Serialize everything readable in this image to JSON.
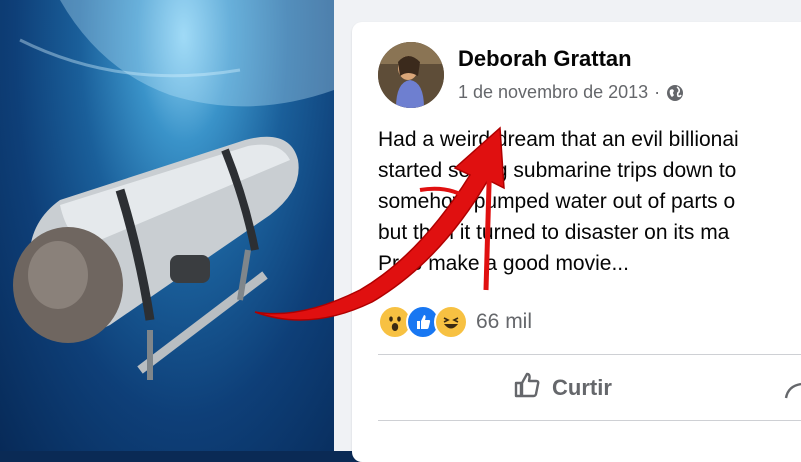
{
  "post": {
    "author_name": "Deborah Grattan",
    "date": "1 de novembro de 2013",
    "separator": "·",
    "privacy_icon": "globe-icon",
    "lines": [
      "Had a weird dream that an evil billionai",
      "started selling submarine trips down to",
      "somehow pumped water out of parts o",
      "but then it turned to disaster on its ma",
      "Prob make a good movie..."
    ],
    "reactions": [
      "wow-icon",
      "like-icon",
      "haha-icon"
    ],
    "reaction_count": "66 mil",
    "like_button_label": "Curtir"
  },
  "colors": {
    "text": "#050505",
    "secondary": "#65676b",
    "like_blue": "#1877f2",
    "arrow_red": "#e01010"
  }
}
